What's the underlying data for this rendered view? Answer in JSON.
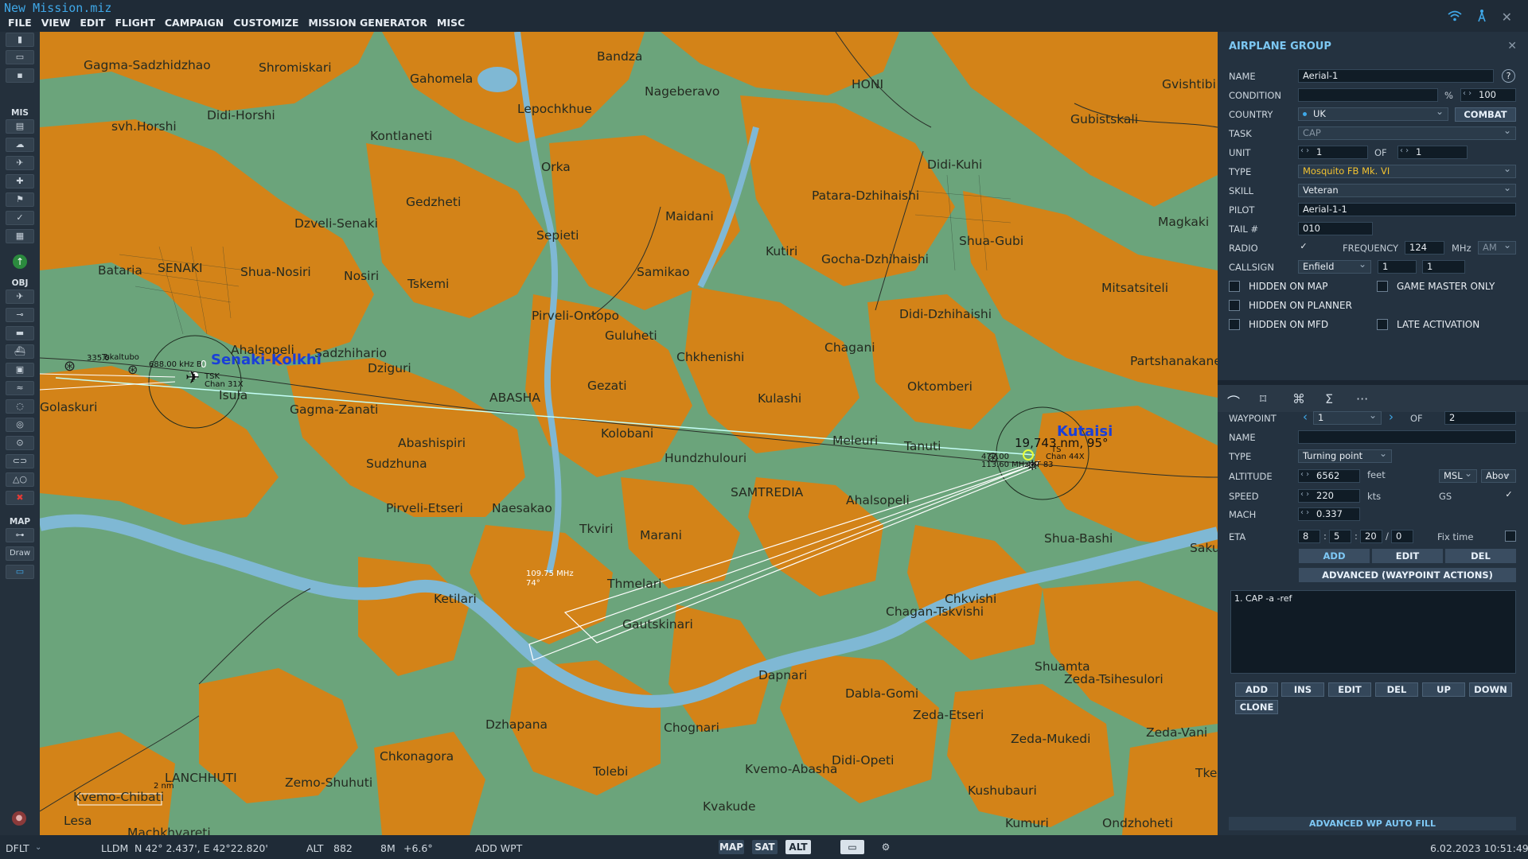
{
  "window": {
    "title": "New Mission.miz"
  },
  "menu": [
    "FILE",
    "VIEW",
    "EDIT",
    "FLIGHT",
    "CAMPAIGN",
    "CUSTOMIZE",
    "MISSION GENERATOR",
    "MISC"
  ],
  "toolbar": {
    "mis_label": "MIS",
    "obj_label": "OBJ",
    "map_label": "MAP",
    "draw_label": "Draw"
  },
  "map": {
    "towns": [
      "Gagma-Sadzhidzhao",
      "Shromiskari",
      "Gahomela",
      "Bandza",
      "HONI",
      "Gvishtibi",
      "svh.Horshi",
      "Didi-Horshi",
      "Lepochkhue",
      "Nageberavo",
      "Gubistskali",
      "Kontlaneti",
      "Didi-Kuhi",
      "Gedzheti",
      "Orka",
      "Dzveli-Senaki",
      "Patara-Dzhihaishi",
      "Maidani",
      "Shua-Gubi",
      "Magkaki",
      "Bataria",
      "SENAKI",
      "Shua-Nosiri",
      "Sepieti",
      "Kutiri",
      "Gocha-Dzhihaishi",
      "Nosiri",
      "Tskemi",
      "Samikao",
      "Mitsatsiteli",
      "Pirveli-Ontopo",
      "Didi-Dzhihaishi",
      "Ahalsopeli",
      "Sadzhihario",
      "Guluheti",
      "Chagani",
      "Partshanakane",
      "Dziguri",
      "Chkhenishi",
      "Golaskuri",
      "Isula",
      "Gezati",
      "ABASHA",
      "Kulashi",
      "Oktomberi",
      "Gagma-Zanati",
      "Kolobani",
      "Meleuri",
      "Tanuti",
      "Abashispiri",
      "Hundzhulouri",
      "Sudzhuna",
      "SAMTREDIA",
      "Pirveli-Etseri",
      "Naesakao",
      "Tkviri",
      "Marani",
      "Ahalsopeli",
      "Shua-Bashi",
      "Sakul",
      "Thmelari",
      "Ketilari",
      "Chkvishi",
      "Gautskinari",
      "Chagan-Tskvishi",
      "Shuamta",
      "Dapnari",
      "Zeda-Tsihesulori",
      "Dabla-Gomi",
      "Zeda-Etseri",
      "Dzhapana",
      "Chognari",
      "Zeda-Vani",
      "Zeda-Mukedi",
      "Chkonagora",
      "Didi-Opeti",
      "LANCHHUTI",
      "Zemo-Shuhuti",
      "Tolebi",
      "Kvemo-Abasha",
      "Kushubauri",
      "Tkelv",
      "Kvemo-Chibati",
      "Kvakude",
      "Lesa",
      "Machkhvareti",
      "Kumuri",
      "Ondzhoheti"
    ],
    "airfields": {
      "senaki": "Senaki-Kolkhi",
      "kutaisi": "Kutaisi"
    },
    "small_labels": {
      "tskaltubo": "Tskaltubo",
      "k688": "688.00 kHz B",
      "k335": "335.0",
      "tsk": "TSK",
      "chan": "Chan 31X",
      "kut1": "477.00",
      "kut2": "113.60 MHz KT 83",
      "kut3": "Chan 44X",
      "kut4": "TS",
      "wp_freq": "109.75 MHz",
      "wp_hdg": "74°",
      "zero": "0",
      "one": "1",
      "scale": "2 nm"
    },
    "bearing": "19,743 nm, 95°"
  },
  "panel": {
    "title": "AIRPLANE GROUP",
    "labels": {
      "name": "NAME",
      "condition": "CONDITION",
      "country": "COUNTRY",
      "task": "TASK",
      "unit": "UNIT",
      "type": "TYPE",
      "skill": "SKILL",
      "pilot": "PILOT",
      "tail": "TAIL #",
      "radio": "RADIO",
      "frequency": "FREQUENCY",
      "callsign": "CALLSIGN",
      "of": "OF",
      "pct": "%",
      "mhz": "MHz"
    },
    "values": {
      "name": "Aerial-1",
      "condition_value": "100",
      "country": "UK",
      "combat": "COMBAT",
      "task": "CAP",
      "unit": "1",
      "unit_of": "1",
      "type": "Mosquito FB Mk. VI",
      "skill": "Veteran",
      "pilot": "Aerial-1-1",
      "tail": "010",
      "frequency": "124",
      "modulation": "AM",
      "callsign": "Enfield",
      "callsign_n1": "1",
      "callsign_n2": "1"
    },
    "checks": {
      "hidden_map": "HIDDEN ON MAP",
      "hidden_planner": "HIDDEN ON PLANNER",
      "hidden_mfd": "HIDDEN ON MFD",
      "game_master": "GAME MASTER ONLY",
      "late_activation": "LATE ACTIVATION"
    },
    "waypoint": {
      "label": "WAYPOINT",
      "value": "1",
      "of_label": "OF",
      "of_value": "2",
      "name_label": "NAME",
      "name_value": "",
      "type_label": "TYPE",
      "type_value": "Turning point",
      "alt_label": "ALTITUDE",
      "alt_value": "6562",
      "alt_unit": "feet",
      "alt_ref": "MSL",
      "alt_mode": "Abov",
      "speed_label": "SPEED",
      "speed_value": "220",
      "speed_unit": "kts",
      "gs_label": "GS",
      "mach_label": "MACH",
      "mach_value": "0.337",
      "eta_label": "ETA",
      "eta_d": "8",
      "eta_h": "5",
      "eta_m": "20",
      "eta_s": "0",
      "fix_time": "Fix time",
      "add": "ADD",
      "edit": "EDIT",
      "del": "DEL",
      "advanced": "ADVANCED (WAYPOINT ACTIONS)"
    },
    "actions": {
      "items": [
        "1. CAP -a -ref"
      ],
      "add": "ADD",
      "ins": "INS",
      "edit": "EDIT",
      "del": "DEL",
      "up": "UP",
      "down": "DOWN",
      "clone": "CLONE"
    },
    "autofill": "ADVANCED WP AUTO FILL"
  },
  "status": {
    "profile": "DFLT",
    "coord_mode": "LLDM",
    "coords": "N 42° 2.437', E 42°22.820'",
    "alt_label": "ALT",
    "alt": "882",
    "mag": "8M",
    "mag_var": "+6.6°",
    "add_wpt": "ADD WPT",
    "map": "MAP",
    "sat": "SAT",
    "alt_btn": "ALT",
    "datetime": "6.02.2023 10:51:49"
  },
  "colors": {
    "accent": "#3fa8e8",
    "land": "#6ba47b",
    "urban": "#d38318",
    "water": "#7fb8d4",
    "airfield_label": "#1a3fd8"
  }
}
